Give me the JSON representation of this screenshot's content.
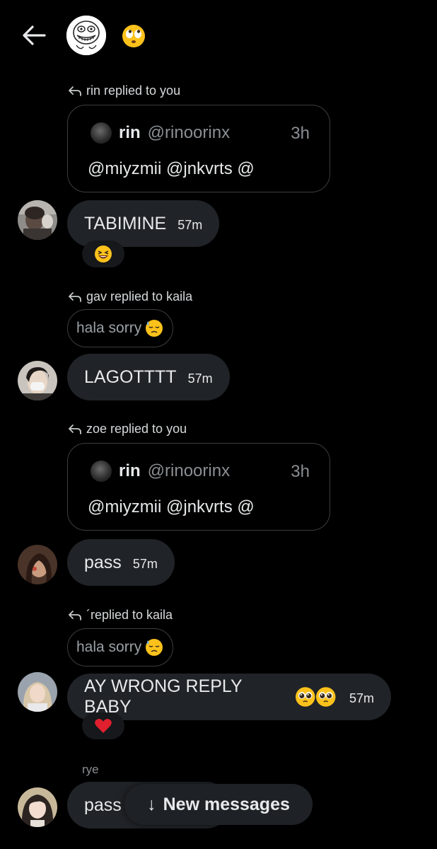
{
  "header": {
    "back_icon": "arrow-left-icon",
    "avatar": "troll-face-avatar",
    "status_emoji": "eye-roll-emoji"
  },
  "messages": [
    {
      "reply_label": "rin replied to you",
      "quote": {
        "name": "rin",
        "handle": "@rinoorinx",
        "time": "3h",
        "body": "@miyzmii @jnkvrts @"
      },
      "text": "TABIMINE",
      "time": "57m",
      "reaction": "laughing-emoji"
    },
    {
      "reply_label": "gav replied to kaila",
      "mini_quote": "hala sorry",
      "text": "LAGOTTTT",
      "time": "57m"
    },
    {
      "reply_label": "zoe replied to you",
      "quote": {
        "name": "rin",
        "handle": "@rinoorinx",
        "time": "3h",
        "body": "@miyzmii @jnkvrts @"
      },
      "text": "pass",
      "time": "57m"
    },
    {
      "reply_label": "´replied to kaila",
      "mini_quote": "hala sorry",
      "text": "AY WRONG REPLY BABY",
      "time": "57m",
      "reaction": "red-heart-emoji"
    },
    {
      "sender": "rye",
      "text": "pass"
    }
  ],
  "new_messages": {
    "arrow": "↓",
    "label": "New messages"
  },
  "colors": {
    "background": "#000000",
    "bubble": "#202327",
    "border": "#3a3d40",
    "muted": "#8a8e92"
  }
}
